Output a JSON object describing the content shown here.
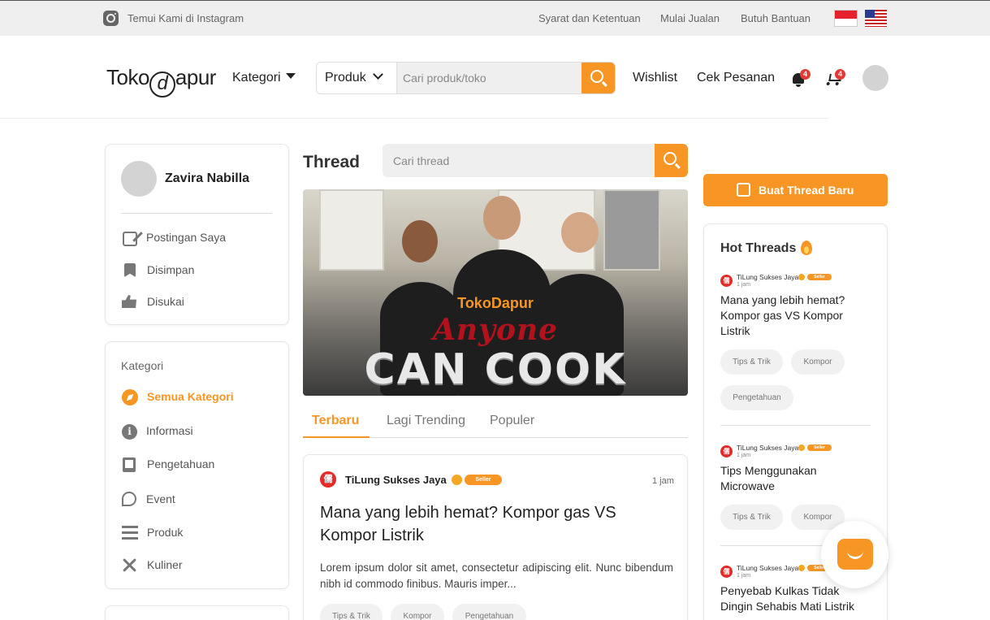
{
  "topbar": {
    "instagram_label": "Temui Kami di Instagram",
    "links": [
      "Syarat dan Ketentuan",
      "Mulai Jualan",
      "Butuh Bantuan"
    ]
  },
  "header": {
    "logo_left": "Toko",
    "logo_mark": "d",
    "logo_right": "apur",
    "kategori_label": "Kategori",
    "search_scope": "Produk",
    "search_placeholder": "Cari produk/toko",
    "wishlist": "Wishlist",
    "cek_pesanan": "Cek Pesanan",
    "notif_count": "4",
    "cart_count": "4"
  },
  "profile": {
    "name": "Zavira Nabilla",
    "menu": [
      "Postingan Saya",
      "Disimpan",
      "Disukai"
    ]
  },
  "categories": {
    "title": "Kategori",
    "items": [
      "Semua Kategori",
      "Informasi",
      "Pengetahuan",
      "Event",
      "Produk",
      "Kuliner"
    ],
    "active": "Semua Kategori"
  },
  "thread": {
    "title": "Thread",
    "search_placeholder": "Cari thread",
    "banner": {
      "brand": "TokoDapur",
      "line1": "Anyone",
      "line2": "CAN COOK"
    },
    "tabs": [
      "Terbaru",
      "Lagi Trending",
      "Populer"
    ],
    "active_tab": "Terbaru",
    "post": {
      "author": "TiLung Sukses Jaya",
      "badge": "Seller",
      "time": "1 jam",
      "title": "Mana yang lebih hemat? Kompor gas VS Kompor Listrik",
      "body": "Lorem ipsum dolor sit amet, consectetur adipiscing elit. Nunc bibendum nibh id commodo finibus. Mauris imper...",
      "tags": [
        "Tips & Trik",
        "Kompor",
        "Pengetahuan"
      ]
    }
  },
  "right": {
    "new_thread_label": "Buat Thread Baru",
    "hot_title": "Hot Threads",
    "hot": [
      {
        "author": "TiLung Sukses Jaya",
        "badge": "Seller",
        "time": "1 jam",
        "title": "Mana yang lebih hemat? Kompor gas VS Kompor Listrik",
        "tags": [
          "Tips & Trik",
          "Kompor",
          "Pengetahuan"
        ]
      },
      {
        "author": "TiLung Sukses Jaya",
        "badge": "Seller",
        "time": "1 jam",
        "title": "Tips Menggunakan Microwave",
        "tags": [
          "Tips & Trik",
          "Kompor"
        ]
      },
      {
        "author": "TiLung Sukses Jaya",
        "badge": "Seller",
        "time": "1 jam",
        "title": "Penyebab Kulkas Tidak Dingin Sehabis Mati Listrik",
        "tags": []
      }
    ]
  },
  "colors": {
    "accent": "#f79624",
    "danger": "#e53935"
  }
}
